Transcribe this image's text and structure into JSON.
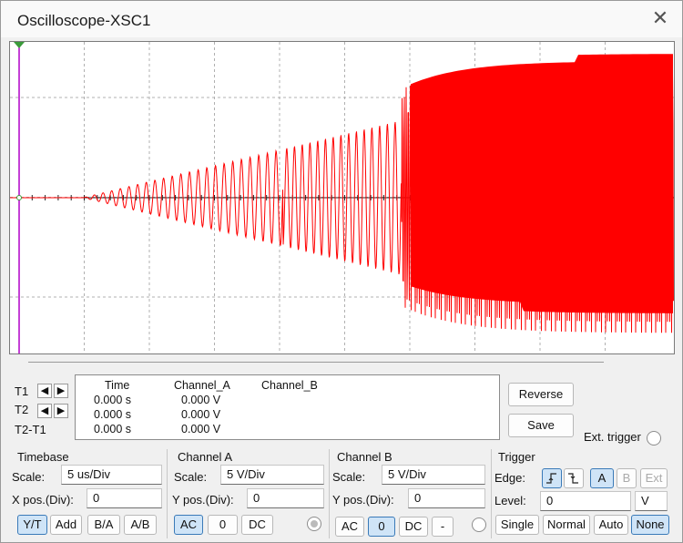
{
  "window": {
    "title": "Oscilloscope-XSC1",
    "close_glyph": "✕"
  },
  "screen": {
    "trace_color": "#ff0000",
    "cursor_color": "#b000c8",
    "grid_color": "#b0b0b0",
    "background": "#ffffff"
  },
  "cursors": {
    "t1_label": "T1",
    "t2_label": "T2",
    "t2t1_label": "T2-T1",
    "left_arrow": "🡐",
    "right_arrow": "🡒",
    "headers": {
      "time": "Time",
      "channel_a": "Channel_A",
      "channel_b": "Channel_B"
    },
    "rows": [
      {
        "time": "0.000 s",
        "channel_a": "0.000 V",
        "channel_b": ""
      },
      {
        "time": "0.000 s",
        "channel_a": "0.000 V",
        "channel_b": ""
      },
      {
        "time": "0.000 s",
        "channel_a": "0.000 V",
        "channel_b": ""
      }
    ]
  },
  "actions": {
    "reverse": "Reverse",
    "save": "Save",
    "ext_trigger": "Ext. trigger"
  },
  "timebase": {
    "title": "Timebase",
    "scale_label": "Scale:",
    "scale_value": "5 us/Div",
    "xpos_label": "X pos.(Div):",
    "xpos_value": "0",
    "modes": [
      "Y/T",
      "Add",
      "B/A",
      "A/B"
    ],
    "selected_mode": "Y/T"
  },
  "channel_a": {
    "title": "Channel A",
    "scale_label": "Scale:",
    "scale_value": "5  V/Div",
    "ypos_label": "Y pos.(Div):",
    "ypos_value": "0",
    "couplings": [
      "AC",
      "0",
      "DC"
    ],
    "selected": "AC"
  },
  "channel_b": {
    "title": "Channel B",
    "scale_label": "Scale:",
    "scale_value": "5  V/Div",
    "ypos_label": "Y pos.(Div):",
    "ypos_value": "0",
    "couplings": [
      "AC",
      "0",
      "DC",
      "-"
    ],
    "selected": "0"
  },
  "trigger": {
    "title": "Trigger",
    "edge_label": "Edge:",
    "rising_glyph": "ᚩ",
    "falling_glyph": "ᚪ",
    "sources": [
      "A",
      "B",
      "Ext"
    ],
    "selected_source": "A",
    "level_label": "Level:",
    "level_value": "0",
    "level_unit": "V",
    "modes": [
      "Single",
      "Normal",
      "Auto",
      "None"
    ],
    "selected_mode": "None"
  }
}
